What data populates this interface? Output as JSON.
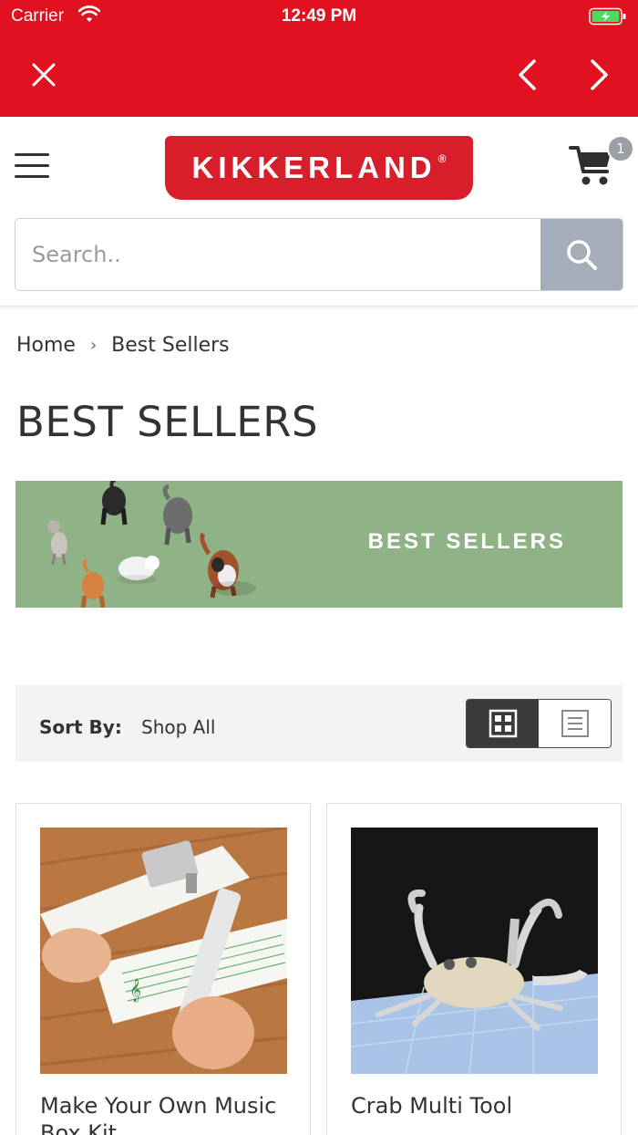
{
  "status_bar": {
    "carrier": "Carrier",
    "time": "12:49 PM"
  },
  "browser_nav": {
    "close_icon": "close-icon",
    "back_icon": "chevron-left-icon",
    "forward_icon": "chevron-right-icon"
  },
  "header": {
    "logo_text": "KIKKERLAND",
    "logo_mark": "®",
    "cart_count": "1"
  },
  "search": {
    "placeholder": "Search.."
  },
  "breadcrumb": {
    "home": "Home",
    "separator": "›",
    "current": "Best Sellers"
  },
  "page_title": "BEST SELLERS",
  "banner": {
    "text": "BEST SELLERS"
  },
  "sort": {
    "label": "Sort By:",
    "value": "Shop All",
    "grid_icon": "grid-view-icon",
    "list_icon": "list-view-icon",
    "active_view": "grid"
  },
  "products": [
    {
      "name": "Make Your Own Music Box Kit"
    },
    {
      "name": "Crab Multi Tool"
    }
  ],
  "colors": {
    "brand_red": "#e0121f",
    "banner_green": "#8fb286",
    "search_button": "#a4adb9"
  }
}
